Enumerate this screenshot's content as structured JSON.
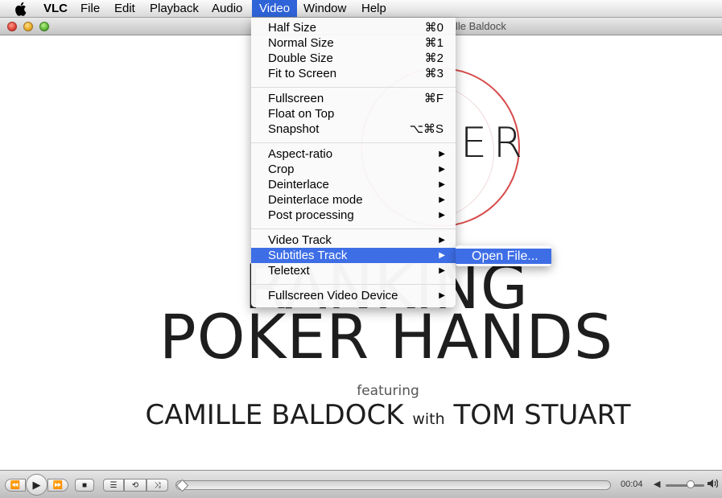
{
  "menubar": {
    "items": [
      {
        "label": "VLC"
      },
      {
        "label": "File"
      },
      {
        "label": "Edit"
      },
      {
        "label": "Playback"
      },
      {
        "label": "Audio"
      },
      {
        "label": "Video"
      },
      {
        "label": "Window"
      },
      {
        "label": "Help"
      }
    ]
  },
  "window": {
    "title": "lle Baldock"
  },
  "video": {
    "logo_text": "ER",
    "title_line1": "RANKING",
    "title_line2": "POKER HANDS",
    "featuring": "featuring",
    "credit_a": "CAMILLE BALDOCK",
    "credit_with": "with",
    "credit_b": "TOM STUART"
  },
  "video_menu": {
    "items": [
      {
        "label": "Half Size",
        "shortcut": "⌘0"
      },
      {
        "label": "Normal Size",
        "shortcut": "⌘1"
      },
      {
        "label": "Double Size",
        "shortcut": "⌘2"
      },
      {
        "label": "Fit to Screen",
        "shortcut": "⌘3"
      },
      {
        "label": "Fullscreen",
        "shortcut": "⌘F"
      },
      {
        "label": "Float on Top",
        "shortcut": ""
      },
      {
        "label": "Snapshot",
        "shortcut": "⌥⌘S"
      },
      {
        "label": "Aspect-ratio",
        "submenu": true
      },
      {
        "label": "Crop",
        "submenu": true
      },
      {
        "label": "Deinterlace",
        "submenu": true
      },
      {
        "label": "Deinterlace mode",
        "submenu": true
      },
      {
        "label": "Post processing",
        "submenu": true
      },
      {
        "label": "Video Track",
        "submenu": true
      },
      {
        "label": "Subtitles Track",
        "submenu": true,
        "highlighted": true
      },
      {
        "label": "Teletext",
        "submenu": true
      },
      {
        "label": "Fullscreen Video Device",
        "submenu": true
      }
    ],
    "submenu_arrow": "▶"
  },
  "subtitles_submenu": {
    "items": [
      {
        "label": "Open File..."
      }
    ]
  },
  "controller": {
    "time": "00:04",
    "volume_fraction": 0.6,
    "seek_fraction": 0.0,
    "icons": {
      "rewind": "⏪",
      "play": "▶",
      "forward": "⏩",
      "stop": "■",
      "playlist": "☰",
      "repeat": "⟲",
      "shuffle": "⤨",
      "volume_low": "◀",
      "volume_high": "🔊"
    }
  },
  "colors": {
    "menu_highlight": "#3e6ee6",
    "logo_ring": "#d64a4a"
  }
}
